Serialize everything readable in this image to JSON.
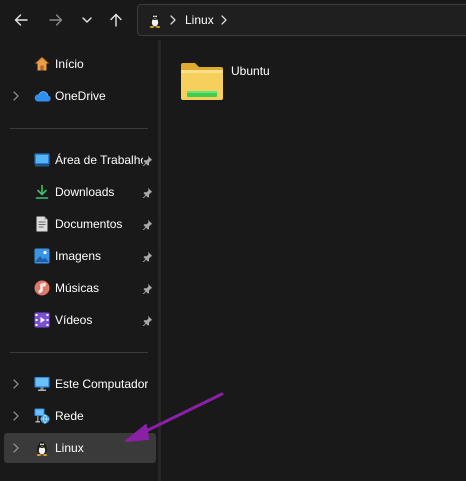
{
  "toolbar": {
    "back_icon": "arrow-left-icon",
    "forward_icon": "arrow-right-icon",
    "recent_icon": "chevron-down-icon",
    "up_icon": "arrow-up-icon"
  },
  "address": {
    "icon": "tux-penguin-icon",
    "crumbs": [
      "Linux"
    ]
  },
  "sidebar": {
    "items": [
      {
        "label": "Início",
        "icon": "home-icon",
        "expandable": false,
        "pinned": false
      },
      {
        "label": "OneDrive",
        "icon": "onedrive-cloud-icon",
        "expandable": true,
        "pinned": false
      },
      {
        "label": "Área de Trabalho",
        "icon": "desktop-icon",
        "expandable": false,
        "pinned": true
      },
      {
        "label": "Downloads",
        "icon": "download-icon",
        "expandable": false,
        "pinned": true
      },
      {
        "label": "Documentos",
        "icon": "document-icon",
        "expandable": false,
        "pinned": true
      },
      {
        "label": "Imagens",
        "icon": "pictures-icon",
        "expandable": false,
        "pinned": true
      },
      {
        "label": "Músicas",
        "icon": "music-icon",
        "expandable": false,
        "pinned": true
      },
      {
        "label": "Vídeos",
        "icon": "videos-icon",
        "expandable": false,
        "pinned": true
      },
      {
        "label": "Este Computador",
        "icon": "this-pc-icon",
        "expandable": true,
        "pinned": false
      },
      {
        "label": "Rede",
        "icon": "network-icon",
        "expandable": true,
        "pinned": false
      },
      {
        "label": "Linux",
        "icon": "tux-penguin-icon",
        "expandable": true,
        "pinned": false,
        "selected": true
      }
    ]
  },
  "content": {
    "items": [
      {
        "label": "Ubuntu",
        "icon": "wsl-folder-icon"
      }
    ]
  },
  "colors": {
    "background": "#191919",
    "selected": "#3a3a3a",
    "annotation_arrow": "#8b1fa8",
    "folder": "#f4c84c",
    "folder_badge": "#3ccf4e"
  }
}
